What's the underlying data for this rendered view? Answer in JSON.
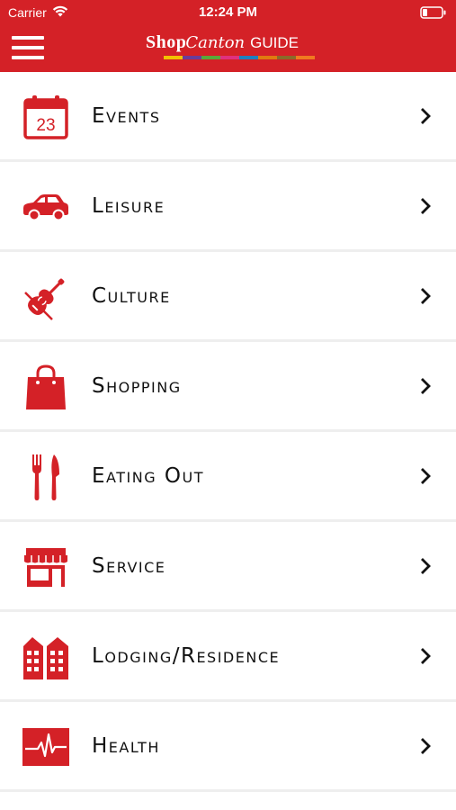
{
  "status": {
    "carrier": "Carrier",
    "time": "12:24 PM"
  },
  "header": {
    "brand_shop": "Shop",
    "brand_canton": "Canton",
    "brand_guide": "GUIDE",
    "stripe_colors": [
      "#f2c100",
      "#6a3d9a",
      "#5aa83a",
      "#e0307f",
      "#1f7fc0",
      "#e07a10",
      "#8a6a2a",
      "#f07a20"
    ]
  },
  "menu": {
    "items": [
      {
        "label": "Events",
        "icon": "calendar-icon",
        "badge": "23"
      },
      {
        "label": "Leisure",
        "icon": "car-icon"
      },
      {
        "label": "Culture",
        "icon": "violin-icon"
      },
      {
        "label": "Shopping",
        "icon": "shopping-bag-icon"
      },
      {
        "label": "Eating Out",
        "icon": "fork-knife-icon"
      },
      {
        "label": "Service",
        "icon": "storefront-icon"
      },
      {
        "label": "Lodging/Residence",
        "icon": "buildings-icon"
      },
      {
        "label": "Health",
        "icon": "heartbeat-icon"
      }
    ]
  },
  "colors": {
    "brand_red": "#d42127",
    "divider": "#eeeeee",
    "text": "#111111"
  }
}
